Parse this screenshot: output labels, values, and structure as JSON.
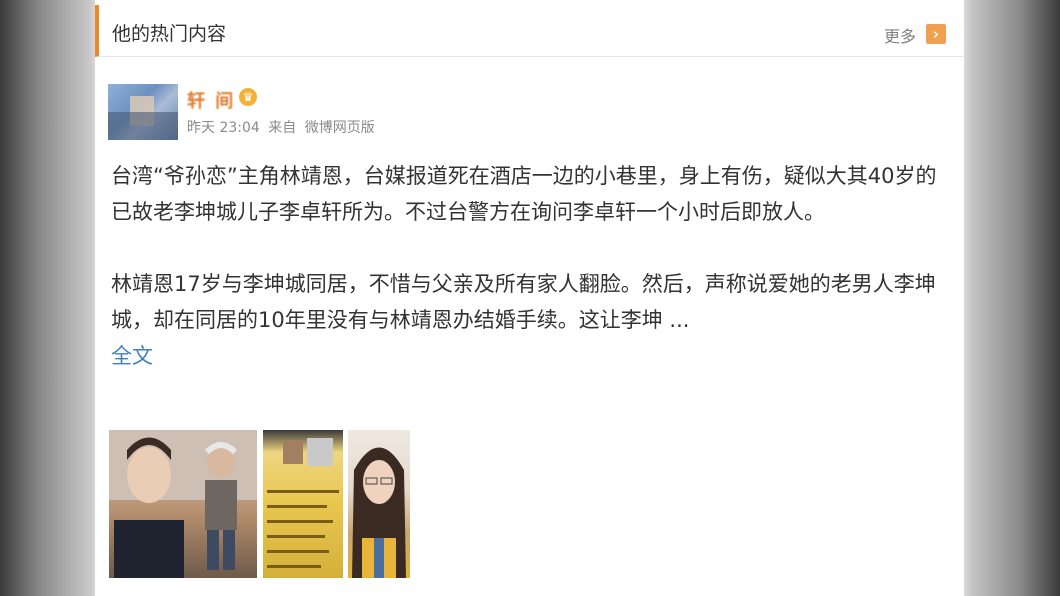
{
  "section": {
    "title": "他的热门内容",
    "more_label": "更多",
    "more_arrow": "›"
  },
  "post": {
    "username": "轩 间",
    "vip_icon": "crown-badge-icon",
    "time": "昨天 23:04",
    "source_prefix": "来自",
    "source": "微博网页版",
    "paragraph1": "台湾“爷孙恋”主角林靖恩，台媒报道死在酒店一边的小巷里，身上有伤，疑似大其40岁的已故老李坤城儿子李卓轩所为。不过台警方在询问李卓轩一个小时后即放人。",
    "paragraph2": "林靖恩17岁与李坤城同居，不惜与父亲及所有家人翻脸。然后，声称说爱她的老男人李坤城，却在同居的10年里没有与林靖恩办结婚手续。这让李坤 ...",
    "expand_label": "全文"
  },
  "colors": {
    "accent": "#e98a2a",
    "link": "#3e7fc4",
    "text": "#333333",
    "meta": "#8a8a8a"
  }
}
